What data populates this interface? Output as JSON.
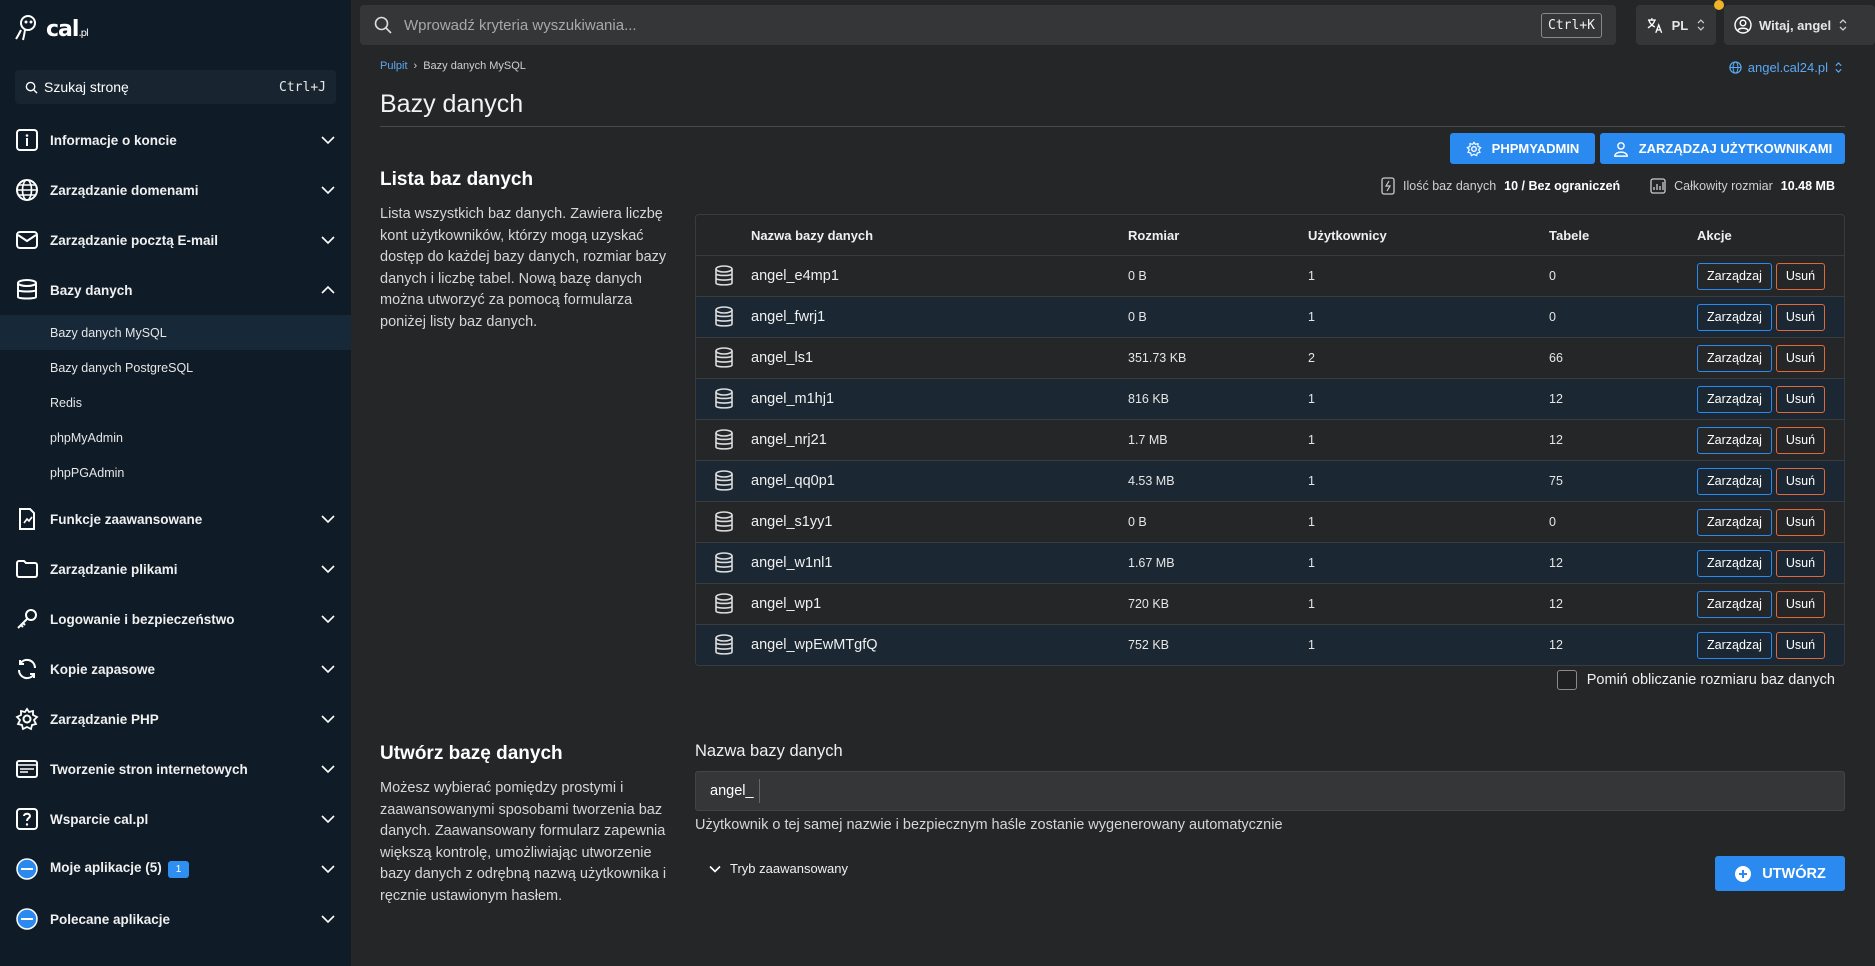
{
  "sidebar": {
    "logo_text": "cal",
    "logo_suffix": ".pl",
    "search_label": "Szukaj stronę",
    "search_shortcut": "Ctrl+J",
    "items": [
      {
        "label": "Informacje o koncie",
        "icon": "info-icon"
      },
      {
        "label": "Zarządzanie domenami",
        "icon": "globe-icon"
      },
      {
        "label": "Zarządzanie pocztą E-mail",
        "icon": "mail-icon"
      },
      {
        "label": "Bazy danych",
        "icon": "database-icon"
      },
      {
        "label": "Funkcje zaawansowane",
        "icon": "advanced-functions-icon"
      },
      {
        "label": "Zarządzanie plikami",
        "icon": "folder-icon"
      },
      {
        "label": "Logowanie i bezpieczeństwo",
        "icon": "key-icon"
      },
      {
        "label": "Kopie zapasowe",
        "icon": "refresh-icon"
      },
      {
        "label": "Zarządzanie PHP",
        "icon": "gear-icon"
      },
      {
        "label": "Tworzenie stron internetowych",
        "icon": "website-builder-icon"
      },
      {
        "label": "Wsparcie cal.pl",
        "icon": "question-icon"
      },
      {
        "label": "Moje aplikacje (5)",
        "icon": "app-icon",
        "badge": "1"
      },
      {
        "label": "Polecane aplikacje",
        "icon": "app-icon"
      }
    ],
    "sub_items": [
      "Bazy danych MySQL",
      "Bazy danych PostgreSQL",
      "Redis",
      "phpMyAdmin",
      "phpPGAdmin"
    ]
  },
  "topbar": {
    "search_placeholder": "Wprowadź kryteria wyszukiwania...",
    "search_shortcut": "Ctrl+K",
    "language": "PL",
    "greeting": "Witaj, angel"
  },
  "breadcrumb": {
    "home": "Pulpit",
    "current": "Bazy danych MySQL"
  },
  "domain": "angel.cal24.pl",
  "page_title": "Bazy danych",
  "buttons": {
    "phpmyadmin": "PHPMYADMIN",
    "manage_users": "ZARZĄDZAJ UŻYTKOWNIKAMI"
  },
  "list_section": {
    "title": "Lista baz danych",
    "description": "Lista wszystkich baz danych. Zawiera liczbę kont użytkowników, którzy mogą uzyskać dostęp do każdej bazy danych, rozmiar bazy danych i liczbę tabel. Nową bazę danych można utworzyć za pomocą formularza poniżej listy baz danych."
  },
  "stats": {
    "count_label": "Ilość baz danych",
    "count_value": "10 / Bez ograniczeń",
    "size_label": "Całkowity rozmiar",
    "size_value": "10.48 MB"
  },
  "table": {
    "headers": {
      "name": "Nazwa bazy danych",
      "size": "Rozmiar",
      "users": "Użytkownicy",
      "tables": "Tabele",
      "actions": "Akcje"
    },
    "manage_label": "Zarządzaj",
    "delete_label": "Usuń",
    "rows": [
      {
        "name": "angel_e4mp1",
        "size": "0 B",
        "users": "1",
        "tables": "0"
      },
      {
        "name": "angel_fwrj1",
        "size": "0 B",
        "users": "1",
        "tables": "0"
      },
      {
        "name": "angel_ls1",
        "size": "351.73 KB",
        "users": "2",
        "tables": "66"
      },
      {
        "name": "angel_m1hj1",
        "size": "816 KB",
        "users": "1",
        "tables": "12"
      },
      {
        "name": "angel_nrj21",
        "size": "1.7 MB",
        "users": "1",
        "tables": "12"
      },
      {
        "name": "angel_qq0p1",
        "size": "4.53 MB",
        "users": "1",
        "tables": "75"
      },
      {
        "name": "angel_s1yy1",
        "size": "0 B",
        "users": "1",
        "tables": "0"
      },
      {
        "name": "angel_w1nl1",
        "size": "1.67 MB",
        "users": "1",
        "tables": "12"
      },
      {
        "name": "angel_wp1",
        "size": "720 KB",
        "users": "1",
        "tables": "12"
      },
      {
        "name": "angel_wpEwMTgfQ",
        "size": "752 KB",
        "users": "1",
        "tables": "12"
      }
    ]
  },
  "skip_size_label": "Pomiń obliczanie rozmiaru baz danych",
  "create_section": {
    "title": "Utwórz bazę danych",
    "description": "Możesz wybierać pomiędzy prostymi i zaawansowanymi sposobami tworzenia baz danych. Zaawansowany formularz zapewnia większą kontrolę, umożliwiając utworzenie bazy danych z odrębną nazwą użytkownika i ręcznie ustawionym hasłem.",
    "field_label": "Nazwa bazy danych",
    "prefix": "angel_",
    "hint": "Użytkownik o tej samej nazwie i bezpiecznym haśle zostanie wygenerowany automatycznie",
    "advanced_label": "Tryb zaawansowany",
    "create_button": "UTWÓRZ"
  },
  "colors": {
    "accent": "#2a8af0",
    "danger": "#e0683a",
    "sidebar_bg": "#0f1b26",
    "content_bg": "#252627"
  }
}
